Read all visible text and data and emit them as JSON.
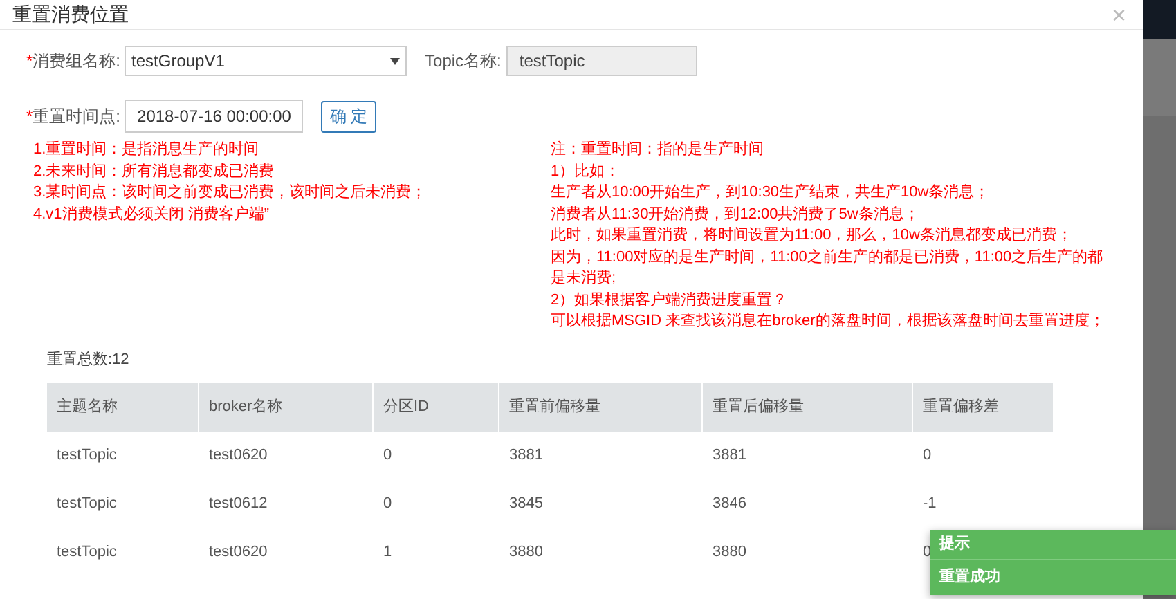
{
  "dialog": {
    "title": "重置消费位置",
    "close": "×"
  },
  "form": {
    "group_label": "消费组名称:",
    "group_value": "testGroupV1",
    "topic_label": "Topic名称:",
    "topic_value": "testTopic",
    "time_label": "重置时间点:",
    "time_value": "2018-07-16 00:00:00",
    "confirm": "确 定",
    "required_mark": "*"
  },
  "notes_left": [
    "1.重置时间：是指消息生产的时间",
    "2.未来时间：所有消息都变成已消费",
    "3.某时间点：该时间之前变成已消费，该时间之后未消费；",
    "4.v1消费模式必须关闭 消费客户端”"
  ],
  "notes_right": [
    "注：重置时间：指的是生产时间",
    "1）比如：",
    "生产者从10:00开始生产，到10:30生产结束，共生产10w条消息；",
    "消费者从11:30开始消费，到12:00共消费了5w条消息；",
    "此时，如果重置消费，将时间设置为11:00，那么，10w条消息都变成已消费；",
    "因为，11:00对应的是生产时间，11:00之前生产的都是已消费，11:00之后生产的都是未消费;",
    "2）如果根据客户端消费进度重置？",
    "可以根据MSGID 来查找该消息在broker的落盘时间，根据该落盘时间去重置进度；"
  ],
  "total": "重置总数:12",
  "table": {
    "columns": [
      "主题名称",
      "broker名称",
      "分区ID",
      "重置前偏移量",
      "重置后偏移量",
      "重置偏移差"
    ],
    "rows": [
      [
        "testTopic",
        "test0620",
        "0",
        "3881",
        "3881",
        "0"
      ],
      [
        "testTopic",
        "test0612",
        "0",
        "3845",
        "3846",
        "-1"
      ],
      [
        "testTopic",
        "test0620",
        "1",
        "3880",
        "3880",
        "0"
      ]
    ]
  },
  "toast": {
    "title": "提示",
    "message": "重置成功"
  }
}
